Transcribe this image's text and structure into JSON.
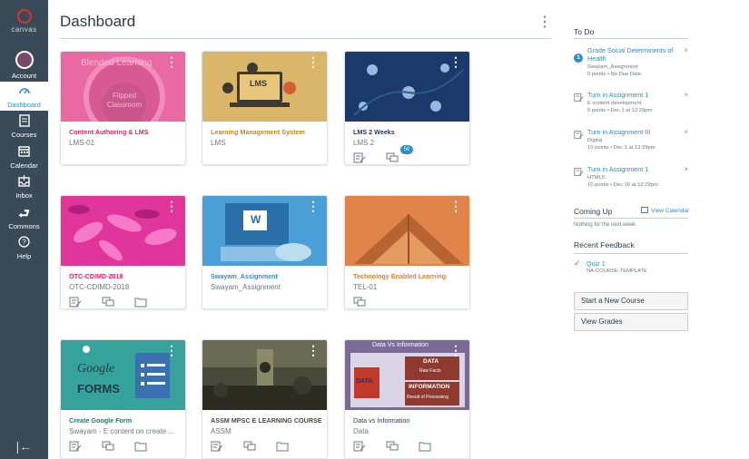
{
  "app": {
    "logo_text": "canvas"
  },
  "nav": {
    "items": [
      {
        "label": "Account",
        "icon": "avatar"
      },
      {
        "label": "Dashboard",
        "icon": "dashboard-icon"
      },
      {
        "label": "Courses",
        "icon": "courses-icon"
      },
      {
        "label": "Calendar",
        "icon": "calendar-icon"
      },
      {
        "label": "Inbox",
        "icon": "inbox-icon"
      },
      {
        "label": "Commons",
        "icon": "commons-icon"
      },
      {
        "label": "Help",
        "icon": "help-icon"
      }
    ],
    "collapse_glyph": "|←"
  },
  "header": {
    "title": "Dashboard",
    "menu_glyph": "⋮"
  },
  "cards": [
    {
      "title": "Content Authoring & LMS",
      "code": "LMS-01",
      "color": "#e91e63",
      "hero_text": "Blended Learning",
      "hero_text2": "Flipped Classroom",
      "actions": []
    },
    {
      "title": "Learning Management System",
      "code": "LMS",
      "color": "#d4a017",
      "hero_text": "LMS",
      "actions": []
    },
    {
      "title": "LMS 2 Weeks",
      "code": "LMS 2",
      "color": "#1b3a6b",
      "actions": [
        "assignments",
        "discussions",
        "files"
      ],
      "badge": "50"
    },
    {
      "title": "OTC-CDIMD-2018",
      "code": "OTC-CDIMD-2018",
      "color": "#e91e63",
      "actions": [
        "assignments",
        "discussions",
        "files"
      ]
    },
    {
      "title": "Swayam_Assignment",
      "code": "Swayam_Assignment",
      "color": "#2d8cd0",
      "hero_text": "W",
      "actions": []
    },
    {
      "title": "Technology Enabled Learning",
      "code": "TEL-01",
      "color": "#e67e22",
      "actions": [
        "discussions"
      ]
    },
    {
      "title": "Create Google Form",
      "code": "Swayam - E content on create ...",
      "color": "#127c78",
      "hero_text": "Google",
      "hero_text2": "FORMS",
      "actions": [
        "assignments",
        "discussions",
        "files"
      ]
    },
    {
      "title": "ASSM MPSC E LEARNING COURSE",
      "code": "ASSM",
      "color": "#4a4a3a",
      "actions": [
        "assignments",
        "discussions",
        "files"
      ]
    },
    {
      "title": "Data vs Information",
      "code": "Data",
      "color": "#6b5a8a",
      "hero_text": "Data Vs Information",
      "hero_data": "DATA",
      "hero_raw": "Raw Facts",
      "hero_info": "INFORMATION",
      "hero_result": "Result of Processing",
      "actions": [
        "assignments",
        "discussions",
        "files"
      ]
    }
  ],
  "todo": {
    "heading": "To Do",
    "items": [
      {
        "number": "1",
        "title": "Grade Social Determinents of Health",
        "course": "Swayam_Assignment",
        "meta": "0 points • No Due Date"
      },
      {
        "title": "Turn in Assignment 1",
        "course": "E content development",
        "meta": "5 points • Dec 1 at 12:29pm"
      },
      {
        "title": "Turn in Assignment-III",
        "course": "Digital",
        "meta": "10 points • Dec 1 at 12:29pm"
      },
      {
        "title": "Turn in Assignment 1",
        "course": "HTML5",
        "meta": "10 points • Dec 16 at 12:29pm"
      }
    ],
    "dismiss_glyph": "×"
  },
  "coming_up": {
    "heading": "Coming Up",
    "view_calendar": "View Calendar",
    "empty": "Nothing for the next week"
  },
  "feedback": {
    "heading": "Recent Feedback",
    "items": [
      {
        "title": "Quiz 1",
        "course": "NA-COURSE-TEMPLATE"
      }
    ]
  },
  "buttons": {
    "start_course": "Start a New Course",
    "view_grades": "View Grades"
  }
}
